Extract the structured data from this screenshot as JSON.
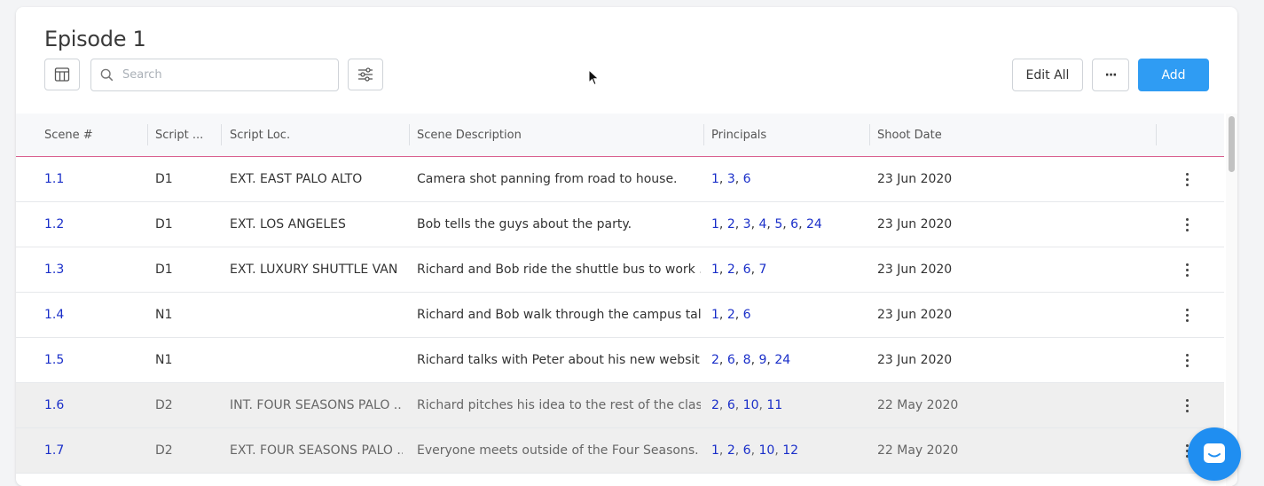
{
  "page": {
    "title": "Episode 1"
  },
  "toolbar": {
    "search_placeholder": "Search",
    "edit_all_label": "Edit All",
    "more_label": "···",
    "add_label": "Add"
  },
  "table": {
    "columns": [
      "Scene #",
      "Script ...",
      "Script Loc.",
      "Scene Description",
      "Principals",
      "Shoot Date"
    ],
    "rows": [
      {
        "scene": "1.1",
        "script_day": "D1",
        "location": "EXT. EAST PALO ALTO",
        "description": "Camera shot panning from road to house.",
        "principals": [
          "1",
          "3",
          "6"
        ],
        "shoot_date": "23 Jun 2020",
        "shaded": false
      },
      {
        "scene": "1.2",
        "script_day": "D1",
        "location": "EXT. LOS ANGELES",
        "description": "Bob tells the guys about the party.",
        "principals": [
          "1",
          "2",
          "3",
          "4",
          "5",
          "6",
          "24"
        ],
        "shoot_date": "23 Jun 2020",
        "shaded": false
      },
      {
        "scene": "1.3",
        "script_day": "D1",
        "location": "EXT. LUXURY SHUTTLE VAN",
        "description": "Richard and Bob ride the shuttle bus to work ...",
        "principals": [
          "1",
          "2",
          "6",
          "7"
        ],
        "shoot_date": "23 Jun 2020",
        "shaded": false
      },
      {
        "scene": "1.4",
        "script_day": "N1",
        "location": "",
        "description": "Richard and Bob walk through the campus tal...",
        "principals": [
          "1",
          "2",
          "6"
        ],
        "shoot_date": "23 Jun 2020",
        "shaded": false
      },
      {
        "scene": "1.5",
        "script_day": "N1",
        "location": "",
        "description": "Richard talks with Peter about his new websit...",
        "principals": [
          "2",
          "6",
          "8",
          "9",
          "24"
        ],
        "shoot_date": "23 Jun 2020",
        "shaded": false
      },
      {
        "scene": "1.6",
        "script_day": "D2",
        "location": "INT. FOUR SEASONS PALO ...",
        "description": "Richard pitches his idea to the rest of the class.",
        "principals": [
          "2",
          "6",
          "10",
          "11"
        ],
        "shoot_date": "22 May 2020",
        "shaded": true
      },
      {
        "scene": "1.7",
        "script_day": "D2",
        "location": "EXT. FOUR SEASONS PALO ...",
        "description": "Everyone meets outside of the Four Seasons.",
        "principals": [
          "1",
          "2",
          "6",
          "10",
          "12"
        ],
        "shoot_date": "22 May 2020",
        "shaded": true
      }
    ]
  },
  "colors": {
    "accent": "#2f9cf3",
    "header_rule": "#d9608f",
    "link": "#1a2fc9",
    "chat": "#1f8ef1"
  },
  "icons": [
    "columns-icon",
    "search-icon",
    "filter-sliders-icon",
    "kebab-menu-icon",
    "chat-icon",
    "mouse-cursor"
  ]
}
